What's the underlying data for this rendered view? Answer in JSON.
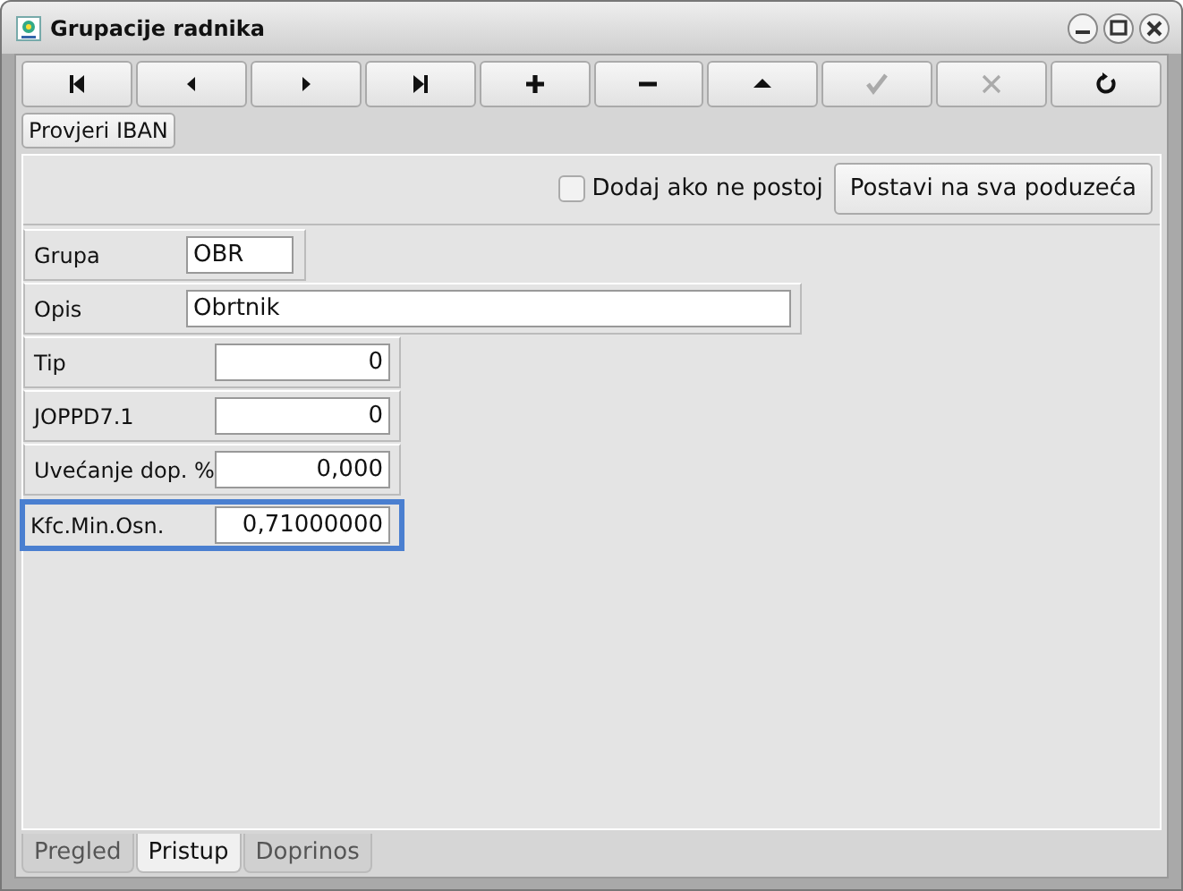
{
  "window": {
    "title": "Grupacije radnika"
  },
  "toolbar": [
    {
      "kind": "first",
      "disabled": false
    },
    {
      "kind": "prev",
      "disabled": false
    },
    {
      "kind": "next",
      "disabled": false
    },
    {
      "kind": "last",
      "disabled": false
    },
    {
      "kind": "add",
      "disabled": false
    },
    {
      "kind": "remove",
      "disabled": false
    },
    {
      "kind": "up",
      "disabled": false
    },
    {
      "kind": "confirm",
      "disabled": true
    },
    {
      "kind": "cancel",
      "disabled": true
    },
    {
      "kind": "refresh",
      "disabled": false
    }
  ],
  "check_iban_button": "Provjeri IBAN",
  "options": {
    "checkbox": {
      "label": "Dodaj ako ne postoj",
      "checked": false
    },
    "button": "Postavi na sva poduzeća"
  },
  "fields": [
    {
      "label": "Grupa",
      "value": "OBR",
      "kind": "short",
      "focused": false
    },
    {
      "label": "Opis",
      "value": "Obrtnik",
      "kind": "wide",
      "focused": false
    },
    {
      "label": "Tip",
      "value": "0",
      "kind": "number",
      "focused": false
    },
    {
      "label": "JOPPD7.1",
      "value": "0",
      "kind": "number",
      "focused": false
    },
    {
      "label": "Uvećanje dop. %",
      "value": "0,000",
      "kind": "number",
      "focused": false
    },
    {
      "label": "Kfc.Min.Osn.",
      "value": "0,71000000",
      "kind": "number",
      "focused": true
    }
  ],
  "tabs": [
    {
      "label": "Pregled",
      "selected": false
    },
    {
      "label": "Pristup",
      "selected": true
    },
    {
      "label": "Doprinos",
      "selected": false
    }
  ]
}
